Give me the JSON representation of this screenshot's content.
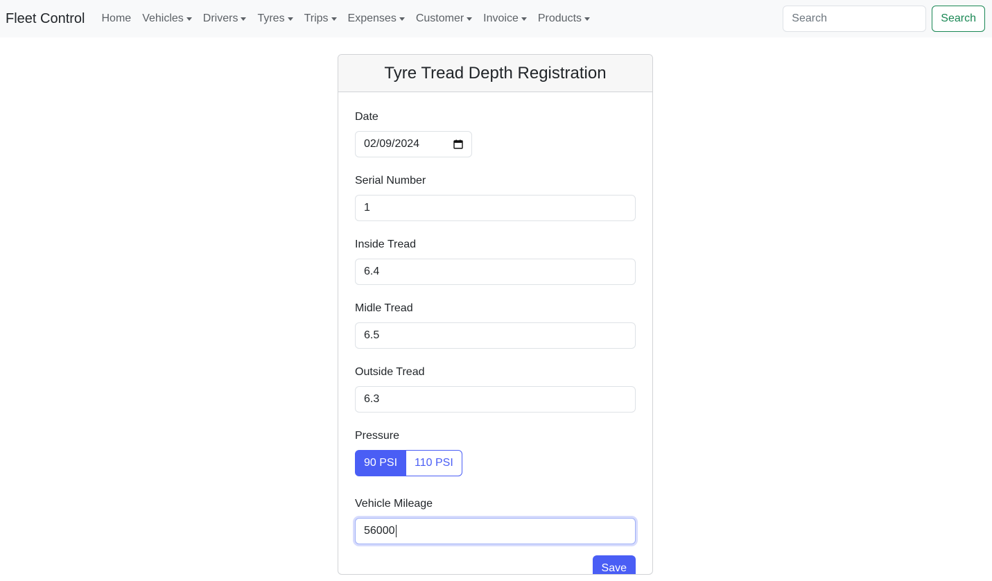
{
  "navbar": {
    "brand": "Fleet Control",
    "items": [
      {
        "label": "Home",
        "dropdown": false
      },
      {
        "label": "Vehicles",
        "dropdown": true
      },
      {
        "label": "Drivers",
        "dropdown": true
      },
      {
        "label": "Tyres",
        "dropdown": true
      },
      {
        "label": "Trips",
        "dropdown": true
      },
      {
        "label": "Expenses",
        "dropdown": true
      },
      {
        "label": "Customer",
        "dropdown": true
      },
      {
        "label": "Invoice",
        "dropdown": true
      },
      {
        "label": "Products",
        "dropdown": true
      }
    ],
    "search_placeholder": "Search",
    "search_button": "Search"
  },
  "form": {
    "title": "Tyre Tread Depth Registration",
    "date": {
      "label": "Date",
      "value": "02/09/2024"
    },
    "serial_number": {
      "label": "Serial Number",
      "value": "1"
    },
    "inside_tread": {
      "label": "Inside Tread",
      "value": "6.4"
    },
    "middle_tread": {
      "label": "Midle Tread",
      "value": "6.5"
    },
    "outside_tread": {
      "label": "Outside Tread",
      "value": "6.3"
    },
    "pressure": {
      "label": "Pressure",
      "options": [
        "90 PSI",
        "110 PSI"
      ],
      "selected": "90 PSI"
    },
    "vehicle_mileage": {
      "label": "Vehicle Mileage",
      "value": "56000"
    },
    "save_label": "Save"
  },
  "colors": {
    "primary": "#4a5ef5",
    "success": "#198754",
    "navbar_bg": "#f8f9fa"
  }
}
